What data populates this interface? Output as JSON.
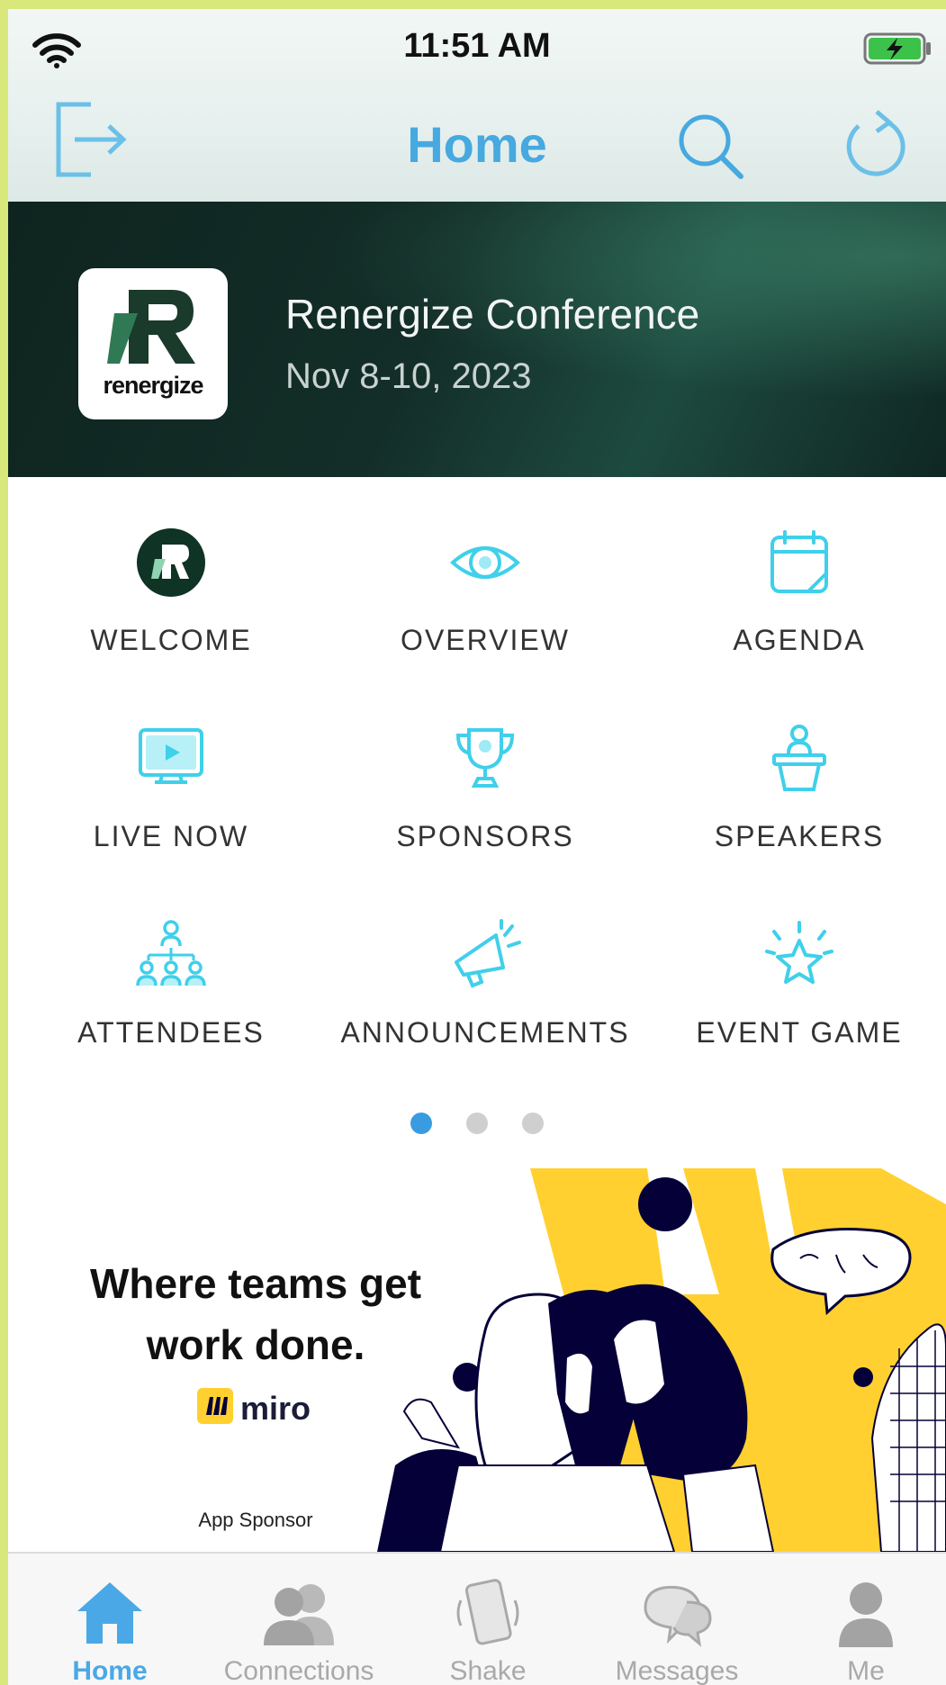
{
  "status_bar": {
    "time": "11:51 AM"
  },
  "nav": {
    "title": "Home"
  },
  "event": {
    "logo_text": "renergize",
    "name": "Renergize Conference",
    "dates": "Nov 8-10, 2023"
  },
  "menu": [
    {
      "label": "WELCOME",
      "icon": "welcome-logo-icon"
    },
    {
      "label": "OVERVIEW",
      "icon": "eye-icon"
    },
    {
      "label": "AGENDA",
      "icon": "calendar-icon"
    },
    {
      "label": "LIVE NOW",
      "icon": "monitor-play-icon"
    },
    {
      "label": "SPONSORS",
      "icon": "trophy-icon"
    },
    {
      "label": "SPEAKERS",
      "icon": "podium-icon"
    },
    {
      "label": "ATTENDEES",
      "icon": "people-network-icon"
    },
    {
      "label": "ANNOUNCEMENTS",
      "icon": "megaphone-icon"
    },
    {
      "label": "EVENT GAME",
      "icon": "star-icon"
    }
  ],
  "pagination": {
    "pages": 3,
    "active": 1
  },
  "sponsor": {
    "headline_line1": "Where teams get",
    "headline_line2": "work done.",
    "brand": "miro",
    "caption": "App Sponsor"
  },
  "tabs": [
    {
      "label": "Home",
      "icon": "home-icon",
      "active": true
    },
    {
      "label": "Connections",
      "icon": "connections-icon",
      "active": false
    },
    {
      "label": "Shake",
      "icon": "shake-phone-icon",
      "active": false
    },
    {
      "label": "Messages",
      "icon": "messages-icon",
      "active": false
    },
    {
      "label": "Me",
      "icon": "person-icon",
      "active": false
    }
  ],
  "colors": {
    "accent": "#46a9e0",
    "icon_cyan": "#3fd0ea",
    "hero_bg": "#132e28",
    "inactive_tab": "#a9a9a9"
  }
}
